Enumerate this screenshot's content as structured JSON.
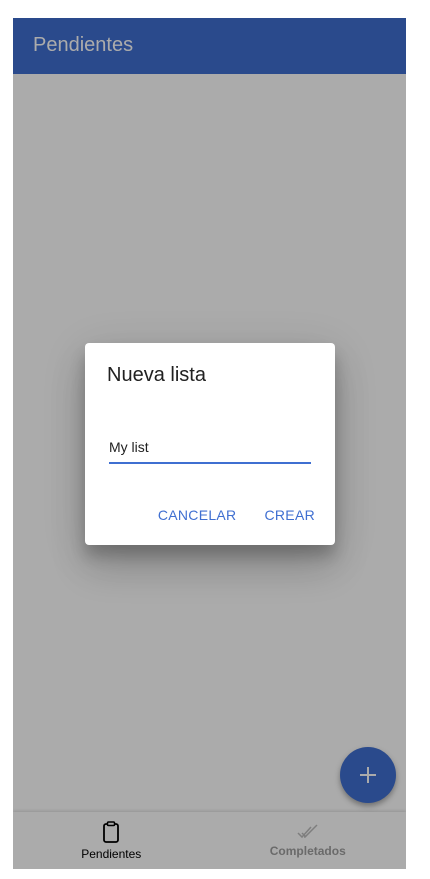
{
  "appbar": {
    "title": "Pendientes"
  },
  "bottom_nav": {
    "items": [
      {
        "label": "Pendientes",
        "icon": "clipboard-icon",
        "active": true
      },
      {
        "label": "Completados",
        "icon": "double-check-icon",
        "active": false
      }
    ]
  },
  "fab": {
    "icon": "plus-icon"
  },
  "dialog": {
    "title": "Nueva lista",
    "input_value": "My list",
    "cancel_label": "CANCELAR",
    "create_label": "CREAR"
  },
  "colors": {
    "primary": "#3f6fd1",
    "scrim": "rgba(0,0,0,0.33)"
  }
}
